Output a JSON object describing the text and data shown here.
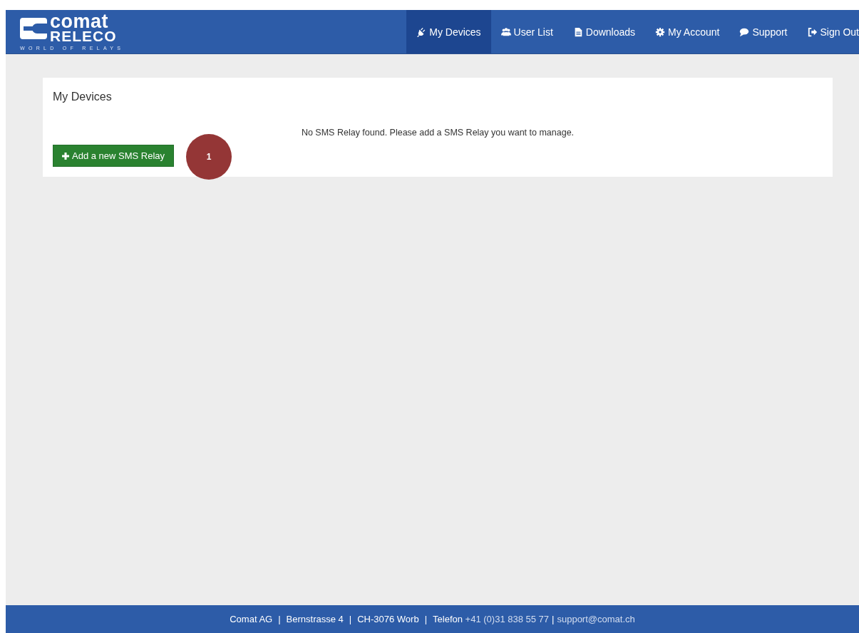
{
  "logo": {
    "name": "comat",
    "sub": "RELECO",
    "tagline": "WORLD OF RELAYS"
  },
  "nav": [
    {
      "label": "My Devices",
      "kind": "plug",
      "selected": true
    },
    {
      "label": "User List",
      "kind": "users",
      "selected": false
    },
    {
      "label": "Downloads",
      "kind": "file",
      "selected": false
    },
    {
      "label": "My Account",
      "kind": "gear",
      "selected": false
    },
    {
      "label": "Support",
      "kind": "speech",
      "selected": false
    },
    {
      "label": "Sign Out",
      "kind": "signout",
      "selected": false
    }
  ],
  "panel": {
    "title": "My Devices",
    "message": "No SMS Relay found. Please add a SMS Relay you want to manage.",
    "button": "Add a new SMS Relay",
    "marker": "1"
  },
  "footer": [
    {
      "kind": "text",
      "text": "Comat AG"
    },
    {
      "kind": "separator",
      "text": "|"
    },
    {
      "kind": "text",
      "text": "Bernstrasse 4"
    },
    {
      "kind": "separator",
      "text": "|"
    },
    {
      "kind": "text",
      "text": "CH-3076 Worb"
    },
    {
      "kind": "separator",
      "text": "|"
    },
    {
      "kind": "text",
      "text": "Telefon"
    },
    {
      "kind": "phone",
      "text": "+41 (0)31 838 55 77"
    },
    {
      "kind": "separator",
      "text": "|"
    },
    {
      "kind": "email",
      "text": "support@comat.ch"
    }
  ]
}
